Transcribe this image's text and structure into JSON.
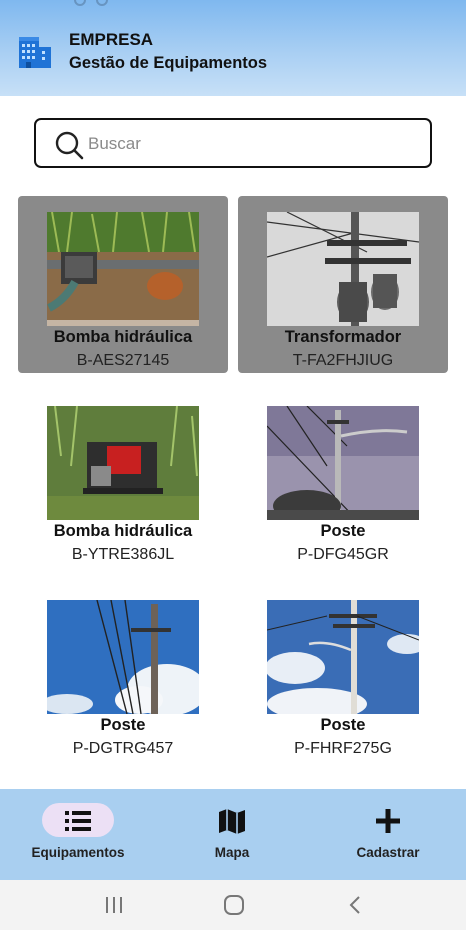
{
  "header": {
    "company": "EMPRESA",
    "subtitle": "Gestão de Equipamentos"
  },
  "search": {
    "placeholder": "Buscar",
    "value": ""
  },
  "equipment": [
    {
      "name": "Bomba hidráulica",
      "code": "B-AES27145",
      "image": "water-pump-photo",
      "selected": true
    },
    {
      "name": "Transformador",
      "code": "T-FA2FHJIUG",
      "image": "transformer-photo",
      "selected": true
    },
    {
      "name": "Bomba hidráulica",
      "code": "B-YTRE386JL",
      "image": "water-pump-photo",
      "selected": false
    },
    {
      "name": "Poste",
      "code": "P-DFG45GR",
      "image": "utility-pole-photo",
      "selected": false
    },
    {
      "name": "Poste",
      "code": "P-DGTRG457",
      "image": "utility-pole-photo",
      "selected": false
    },
    {
      "name": "Poste",
      "code": "P-FHRF275G",
      "image": "utility-pole-photo",
      "selected": false
    }
  ],
  "nav": {
    "items": [
      {
        "label": "Equipamentos",
        "icon": "list-icon",
        "active": true
      },
      {
        "label": "Mapa",
        "icon": "map-icon",
        "active": false
      },
      {
        "label": "Cadastrar",
        "icon": "plus-icon",
        "active": false
      }
    ]
  },
  "system_nav": [
    "recents-icon",
    "home-icon",
    "back-icon"
  ],
  "colors": {
    "header_top": "#7fb8ef",
    "bottom_nav": "#a9cff0",
    "selected_card": "#8a8a8a",
    "active_pill": "#ece0f5"
  }
}
